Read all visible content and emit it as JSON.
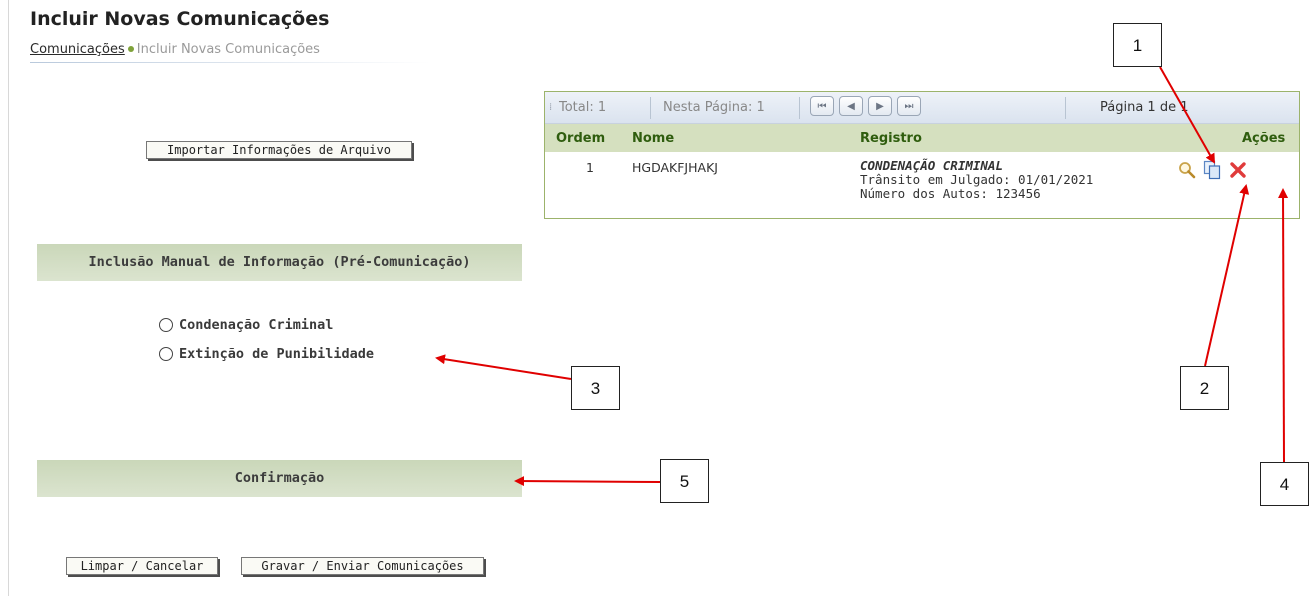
{
  "page": {
    "title": "Incluir Novas Comunicações",
    "breadcrumb": {
      "link": "Comunicações",
      "current": "Incluir Novas Comunicações"
    }
  },
  "import_button": "Importar Informações de Arquivo",
  "manual_section": {
    "title": "Inclusão Manual de Informação (Pré-Comunicação)",
    "options": [
      "Condenação Criminal",
      "Extinção de Punibilidade"
    ]
  },
  "confirm_section": {
    "title": "Confirmação",
    "clear_button": "Limpar / Cancelar",
    "save_button": "Gravar / Enviar Comunicações"
  },
  "grid": {
    "toolbar": {
      "total": "Total: 1",
      "page_items": "Nesta Página: 1",
      "page_count": "Página 1 de 1"
    },
    "nav_buttons": [
      "first-page",
      "previous-page",
      "next-page",
      "last-page"
    ],
    "headers": {
      "ordem": "Ordem",
      "nome": "Nome",
      "registro": "Registro",
      "acoes": "Ações"
    },
    "rows": [
      {
        "ordem": "1",
        "nome": "HGDAKFJHAKJ",
        "registro_title": "CONDENAÇÃO CRIMINAL",
        "registro_line2": "Trânsito em Julgado: 01/01/2021",
        "registro_line3": "Número dos Autos: 123456",
        "actions": [
          "magnifier-icon",
          "copy-icon",
          "delete-x-icon"
        ]
      }
    ]
  },
  "callouts": [
    "1",
    "2",
    "3",
    "4",
    "5"
  ],
  "colors": {
    "header_green": "#2f5d0e",
    "section_bar": "#cad7b9",
    "grid_border": "#9cb36b",
    "arrow_red": "#e00000"
  }
}
